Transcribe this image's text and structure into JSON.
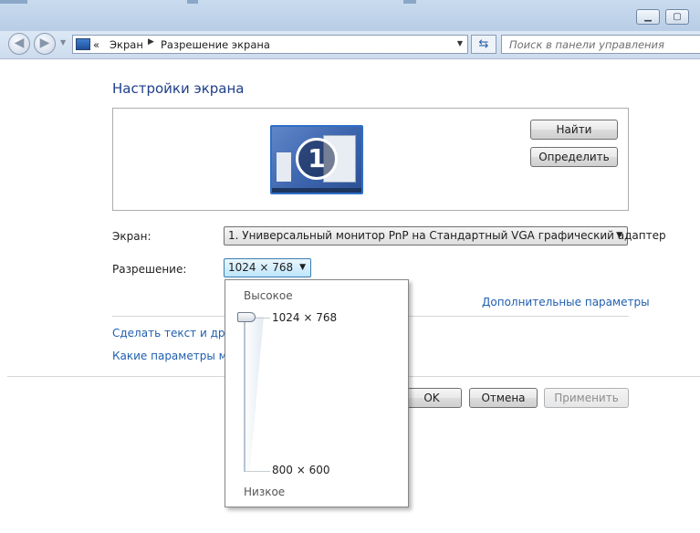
{
  "nav": {
    "back_label": "◀",
    "forward_label": "▶",
    "breadcrumb": [
      {
        "label": "«"
      },
      {
        "label": "Экран"
      },
      {
        "label": "Разрешение экрана"
      }
    ],
    "search_placeholder": "Поиск в панели управления"
  },
  "window_controls": {
    "minimize": "▁",
    "maximize": "▢"
  },
  "content": {
    "title": "Настройки экрана",
    "monitor_number": "1",
    "identify_buttons": {
      "find": "Найти",
      "identify": "Определить"
    },
    "display_label": "Экран:",
    "display_value": "1. Универсальный монитор PnP на Стандартный VGA графический адаптер",
    "resolution_label": "Разрешение:",
    "resolution_value": "1024 × 768",
    "advanced_link": "Дополнительные параметры",
    "link_text_size": "Сделать текст и други",
    "link_which_params": "Какие параметры мон"
  },
  "dropdown": {
    "high_label": "Высокое",
    "low_label": "Низкое",
    "current_value": "1024 × 768",
    "min_value": "800 × 600",
    "slider_position": 1.0
  },
  "footer_buttons": {
    "ok": "OK",
    "cancel": "Отмена",
    "apply": "Применить"
  }
}
